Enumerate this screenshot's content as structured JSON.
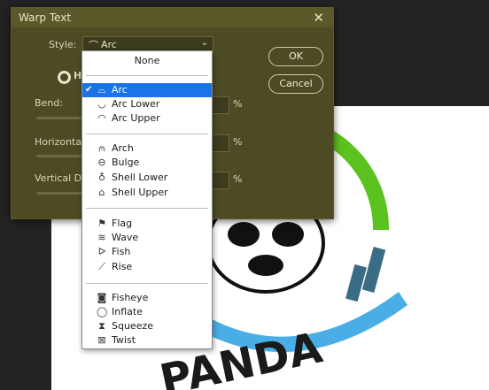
{
  "dialog": {
    "title": "Warp Text",
    "style_label": "Style:",
    "style_value": "Arc",
    "orientation_label": "H",
    "bend_label": "Bend:",
    "horizontal_label": "Horizonta",
    "vertical_label": "Vertical D",
    "percent": "%",
    "ok_label": "OK",
    "cancel_label": "Cancel"
  },
  "menu": {
    "none_label": "None",
    "items": [
      {
        "label": "Arc",
        "icon": "arc-icon",
        "selected": true
      },
      {
        "label": "Arc Lower",
        "icon": "arc-lower-icon"
      },
      {
        "label": "Arc Upper",
        "icon": "arc-upper-icon"
      },
      {
        "label": "Arch",
        "icon": "arch-icon"
      },
      {
        "label": "Bulge",
        "icon": "bulge-icon"
      },
      {
        "label": "Shell Lower",
        "icon": "shell-lower-icon"
      },
      {
        "label": "Shell Upper",
        "icon": "shell-upper-icon"
      },
      {
        "label": "Flag",
        "icon": "flag-icon"
      },
      {
        "label": "Wave",
        "icon": "wave-icon"
      },
      {
        "label": "Fish",
        "icon": "fish-icon"
      },
      {
        "label": "Rise",
        "icon": "rise-icon"
      },
      {
        "label": "Fisheye",
        "icon": "fisheye-icon"
      },
      {
        "label": "Inflate",
        "icon": "inflate-icon"
      },
      {
        "label": "Squeeze",
        "icon": "squeeze-icon"
      },
      {
        "label": "Twist",
        "icon": "twist-icon"
      }
    ]
  },
  "artwork": {
    "logo_text": "PANDA"
  },
  "colors": {
    "dialog_bg": "#4d4b24",
    "selection": "#1a73e8",
    "logo_green": "#5cc21f",
    "logo_blue": "#4aaee6"
  }
}
